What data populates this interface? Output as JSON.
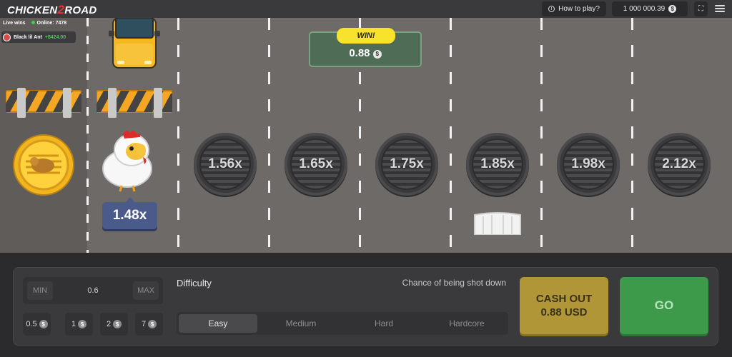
{
  "header": {
    "logo_part1": "CHICKEN",
    "logo_part2": "2",
    "logo_part3": "ROAD",
    "how_to_play": "How to play?",
    "balance": "1 000 000.39",
    "currency_symbol": "$"
  },
  "live": {
    "label": "Live wins",
    "online": "Online: 7478",
    "winner_name": "Black lil Ant",
    "winner_amount": "+$424.00"
  },
  "game": {
    "current_multiplier": "1.48x",
    "multipliers": [
      "1.56x",
      "1.65x",
      "1.75x",
      "1.85x",
      "1.98x",
      "2.12x"
    ],
    "win_label": "WIN!",
    "win_amount": "0.88"
  },
  "controls": {
    "min_label": "MIN",
    "max_label": "MAX",
    "bet_value": "0.6",
    "quick_bets": [
      "0.5",
      "1",
      "2",
      "7"
    ],
    "difficulty_label": "Difficulty",
    "chance_label": "Chance of being shot down",
    "difficulties": [
      "Easy",
      "Medium",
      "Hard",
      "Hardcore"
    ],
    "active_difficulty": "Easy",
    "cashout_label": "CASH OUT",
    "cashout_amount": "0.88 USD",
    "go_label": "GO"
  },
  "colors": {
    "road": "#6e6a68",
    "go_button": "#3d9a4a",
    "cashout_button": "#b19637",
    "win_badge": "#f7e32c"
  }
}
